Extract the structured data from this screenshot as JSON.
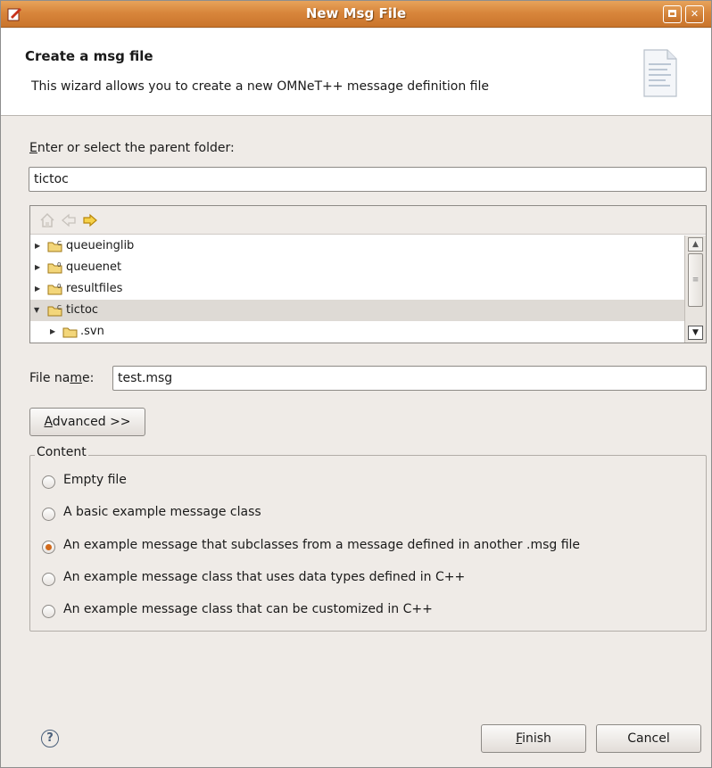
{
  "window": {
    "title": "New Msg File",
    "accent_color": "#d8863c"
  },
  "banner": {
    "heading": "Create a msg file",
    "description": "This wizard allows you to create a new OMNeT++ message definition file"
  },
  "parent_folder": {
    "label_mnemonic": "E",
    "label_rest": "nter or select the parent folder:",
    "value": "tictoc"
  },
  "tree": {
    "toolbar_icons": [
      "home-icon",
      "back-arrow-icon",
      "forward-arrow-icon"
    ],
    "rows": [
      {
        "name": "queueinglib",
        "expanded": false,
        "selected": false,
        "badge": "C"
      },
      {
        "name": "queuenet",
        "expanded": false,
        "selected": false,
        "badge": "0"
      },
      {
        "name": "resultfiles",
        "expanded": false,
        "selected": false,
        "badge": "0"
      },
      {
        "name": "tictoc",
        "expanded": true,
        "selected": true,
        "badge": "C"
      },
      {
        "name": ".svn",
        "expanded": false,
        "selected": false,
        "badge": ""
      }
    ]
  },
  "file_name": {
    "label_before": "File na",
    "label_mnemonic": "m",
    "label_after": "e:",
    "value": "test.msg"
  },
  "advanced_button": {
    "mnemonic": "A",
    "rest": "dvanced >>"
  },
  "content": {
    "title": "Content",
    "options": [
      {
        "label": "Empty file",
        "selected": false
      },
      {
        "label": "A basic example message class",
        "selected": false
      },
      {
        "label": "An example message that subclasses from a message defined in another .msg file",
        "selected": true
      },
      {
        "label": "An example message class that uses data types defined in C++",
        "selected": false
      },
      {
        "label": "An example message class that can be customized in C++",
        "selected": false
      }
    ]
  },
  "footer": {
    "help_glyph": "?",
    "finish_mnemonic": "F",
    "finish_rest": "inish",
    "cancel_label": "Cancel"
  }
}
